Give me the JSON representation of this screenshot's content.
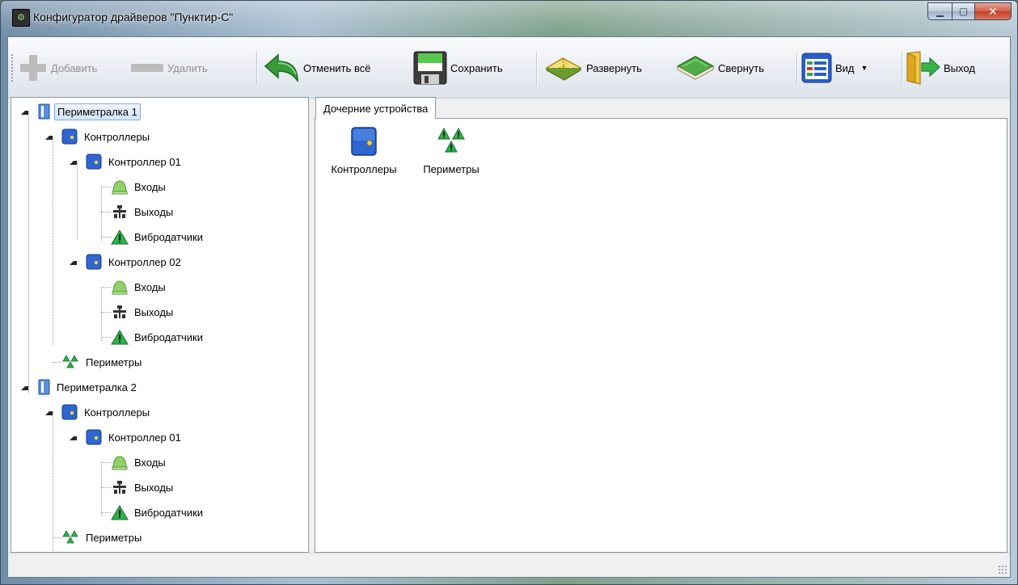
{
  "window": {
    "title": "Конфигуратор драйверов \"Пунктир-С\"",
    "icon": "app-icon",
    "controls": {
      "minimize": "minimize-icon",
      "maximize": "maximize-icon",
      "close": "close-icon"
    }
  },
  "toolbar": {
    "add_label": "Добавить",
    "delete_label": "Удалить",
    "revert_label": "Отменить всё",
    "save_label": "Сохранить",
    "expand_label": "Развернуть",
    "collapse_label": "Свернуть",
    "view_label": "Вид",
    "exit_label": "Выход",
    "disabled_items": [
      "Добавить",
      "Удалить"
    ]
  },
  "tree": {
    "nodes": [
      {
        "label": "Периметралка 1",
        "icon": "perimeter-device-icon",
        "level": 0,
        "expanded": true,
        "selected": true
      },
      {
        "label": "Контроллеры",
        "icon": "controller-icon",
        "level": 1,
        "expanded": true
      },
      {
        "label": "Контроллер 01",
        "icon": "controller-icon",
        "level": 2,
        "expanded": true
      },
      {
        "label": "Входы",
        "icon": "bell-icon",
        "level": 3
      },
      {
        "label": "Выходы",
        "icon": "relay-icon",
        "level": 3
      },
      {
        "label": "Вибродатчики",
        "icon": "warning-icon",
        "level": 3
      },
      {
        "label": "Контроллер 02",
        "icon": "controller-icon",
        "level": 2,
        "expanded": true
      },
      {
        "label": "Входы",
        "icon": "bell-icon",
        "level": 3
      },
      {
        "label": "Выходы",
        "icon": "relay-icon",
        "level": 3
      },
      {
        "label": "Вибродатчики",
        "icon": "warning-icon",
        "level": 3
      },
      {
        "label": "Периметры",
        "icon": "multi-warning-icon",
        "level": 1
      },
      {
        "label": "Периметралка 2",
        "icon": "perimeter-device-icon",
        "level": 0,
        "expanded": true
      },
      {
        "label": "Контроллеры",
        "icon": "controller-icon",
        "level": 1,
        "expanded": true
      },
      {
        "label": "Контроллер 01",
        "icon": "controller-icon",
        "level": 2,
        "expanded": true
      },
      {
        "label": "Входы",
        "icon": "bell-icon",
        "level": 3
      },
      {
        "label": "Выходы",
        "icon": "relay-icon",
        "level": 3
      },
      {
        "label": "Вибродатчики",
        "icon": "warning-icon",
        "level": 3
      },
      {
        "label": "Периметры",
        "icon": "multi-warning-icon",
        "level": 1
      }
    ]
  },
  "details": {
    "tab_label": "Дочерние устройства",
    "items": [
      {
        "label": "Контроллеры",
        "icon": "controller-large-icon"
      },
      {
        "label": "Периметры",
        "icon": "multi-warning-large-icon"
      }
    ]
  },
  "colors": {
    "selection_border": "#84acdd",
    "selection_fill": "#d3e4fa",
    "controller_blue": "#2f66d0",
    "warning_green": "#2fb24c",
    "bell_green": "#8fd16a"
  }
}
